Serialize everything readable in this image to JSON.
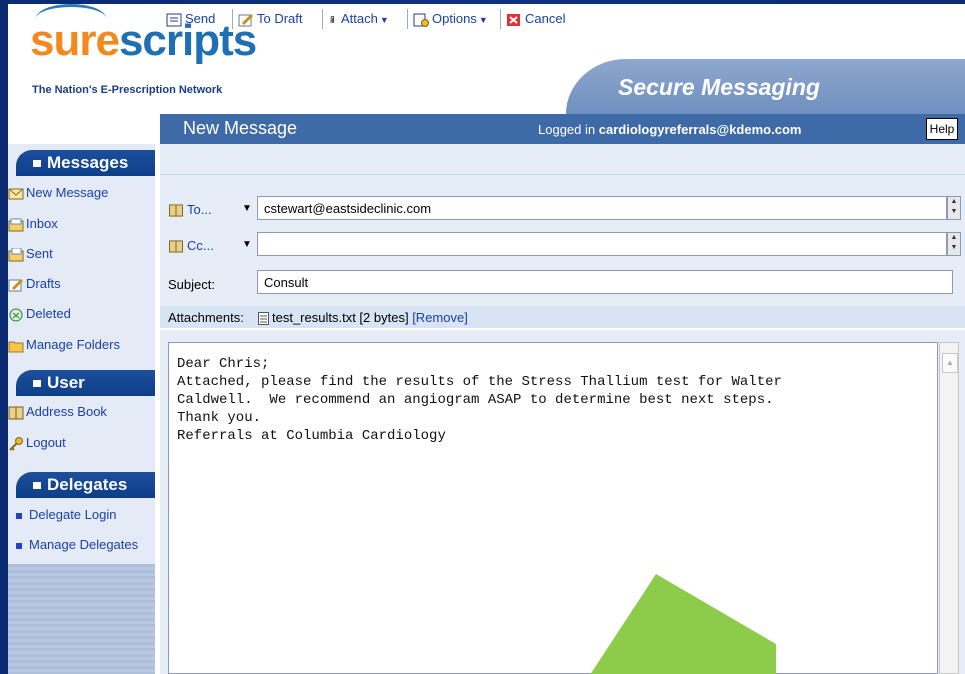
{
  "brand": {
    "logo_text_1": "sure",
    "logo_text_2": "scripts",
    "tagline": "The Nation's E-Prescription Network",
    "orange": "#f2891f",
    "blue": "#1e6fb3"
  },
  "header": {
    "section_title": "Secure Messaging",
    "page_title": "New Message",
    "logged_in_prefix": "Logged in",
    "logged_in_user": "cardiologyreferrals@kdemo.com",
    "help_label": "Help"
  },
  "sidebar": {
    "messages_heading": "Messages",
    "messages_items": [
      {
        "label": "New Message",
        "icon": "new-message-icon"
      },
      {
        "label": "Inbox",
        "icon": "inbox-icon"
      },
      {
        "label": "Sent",
        "icon": "sent-icon"
      },
      {
        "label": "Drafts",
        "icon": "drafts-icon"
      },
      {
        "label": "Deleted",
        "icon": "deleted-icon"
      },
      {
        "label": "Manage Folders",
        "icon": "folder-icon"
      }
    ],
    "user_heading": "User",
    "user_items": [
      {
        "label": "Address Book",
        "icon": "address-book-icon"
      },
      {
        "label": "Logout",
        "icon": "key-icon"
      }
    ],
    "delegates_heading": "Delegates",
    "delegates_items": [
      {
        "label": "Delegate Login"
      },
      {
        "label": "Manage Delegates"
      }
    ]
  },
  "toolbar": {
    "send": "Send",
    "to_draft": "To Draft",
    "attach": "Attach",
    "options": "Options",
    "cancel": "Cancel"
  },
  "form": {
    "to_label": "To...",
    "to_value": "cstewart@eastsideclinic.com",
    "cc_label": "Cc...",
    "cc_value": "",
    "subject_label": "Subject:",
    "subject_value": "Consult",
    "attachments_label": "Attachments:",
    "attachment_name": "test_results.txt [2 bytes]",
    "remove_label": "[Remove]"
  },
  "message": {
    "lines": [
      "Dear Chris;",
      "",
      "Attached, please find the results of the Stress Thallium test for Walter",
      "Caldwell.  We recommend an angiogram ASAP to determine best next steps.",
      "",
      "Thank you.",
      "",
      "",
      "Referrals at Columbia Cardiology"
    ]
  },
  "colors": {
    "slide_bg": "#0b2a6e",
    "bar_blue": "#3e6aa8",
    "arrow_green": "#8ccc4a"
  }
}
